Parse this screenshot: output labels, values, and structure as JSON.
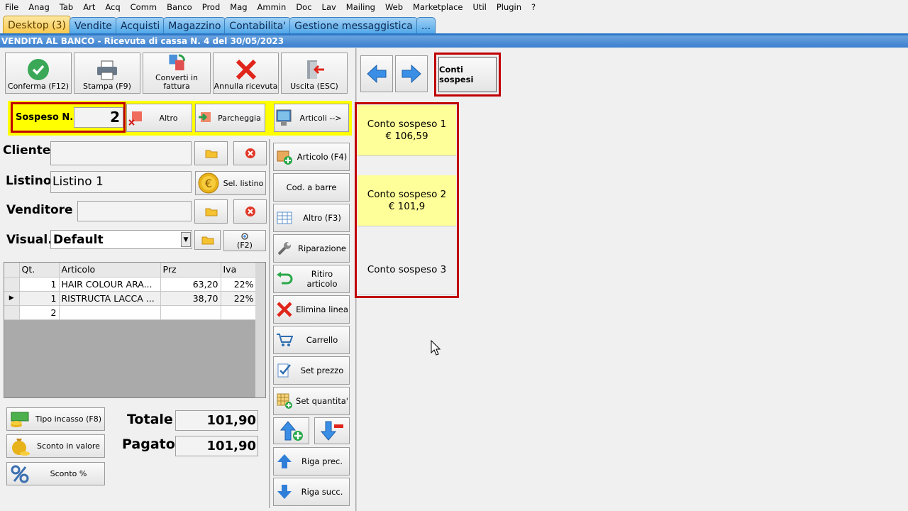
{
  "menu": [
    "File",
    "Anag",
    "Tab",
    "Art",
    "Acq",
    "Comm",
    "Banco",
    "Prod",
    "Mag",
    "Ammin",
    "Doc",
    "Lav",
    "Mailing",
    "Web",
    "Marketplace",
    "Util",
    "Plugin",
    "?"
  ],
  "tabs": [
    "Desktop (3)",
    "Vendite",
    "Acquisti",
    "Magazzino",
    "Contabilita'",
    "Gestione messaggistica",
    "..."
  ],
  "window_title": "VENDITA AL BANCO - Ricevuta di cassa N. 4 del 30/05/2023",
  "toolbar": {
    "confirm": "Conferma (F12)",
    "print": "Stampa (F9)",
    "convert_1": "Converti in",
    "convert_2": "fattura",
    "cancel": "Annulla ricevuta",
    "exit": "Uscita (ESC)",
    "conti_sospesi": "Conti sospesi"
  },
  "sospeso": {
    "label": "Sospeso N.",
    "value": "2"
  },
  "actions": {
    "altro": "Altro",
    "parcheggia": "Parcheggia",
    "articoli": "Articoli -->"
  },
  "form": {
    "cliente_label": "Cliente",
    "cliente_value": "",
    "listino_label": "Listino",
    "listino_value": "Listino 1",
    "sel_listino": "Sel. listino",
    "venditore_label": "Venditore",
    "venditore_value": "",
    "visual_label": "Visual.",
    "visual_value": "Default",
    "f2": "(F2)"
  },
  "grid": {
    "headers": [
      "Qt.",
      "Articolo",
      "Prz",
      "Iva"
    ],
    "rows": [
      {
        "qt": "1",
        "articolo": "HAIR COLOUR ARA...",
        "prz": "63,20",
        "iva": "22%"
      },
      {
        "qt": "1",
        "articolo": "RISTRUCTA LACCA ...",
        "prz": "38,70",
        "iva": "22%"
      },
      {
        "qt": "2",
        "articolo": "",
        "prz": "",
        "iva": ""
      }
    ]
  },
  "side_buttons": {
    "articolo": "Articolo (F4)",
    "barcode": "Cod. a barre",
    "altro": "Altro (F3)",
    "riparazione": "Riparazione",
    "ritiro": "Ritiro articolo",
    "elimina": "Elimina linea",
    "carrello": "Carrello",
    "set_prezzo": "Set prezzo",
    "set_quantita": "Set quantita'",
    "riga_prec": "Riga prec.",
    "riga_succ": "Riga succ."
  },
  "bottom": {
    "tipo_incasso": "Tipo incasso (F8)",
    "sconto_valore": "Sconto in valore",
    "sconto_perc": "Sconto %",
    "totale_label": "Totale",
    "totale_value": "101,90",
    "pagato_label": "Pagato",
    "pagato_value": "101,90"
  },
  "conti": [
    {
      "name": "Conto sospeso 1",
      "amount": "€ 106,59"
    },
    {
      "name": "Conto sospeso 2",
      "amount": "€ 101,9"
    },
    {
      "name": "Conto sospeso 3",
      "amount": ""
    }
  ],
  "colors": {
    "highlight_yellow": "#ffff00",
    "red_frame": "#c00000",
    "conto_yellow": "#ffff99",
    "tab_blue": "#2e78c8"
  }
}
